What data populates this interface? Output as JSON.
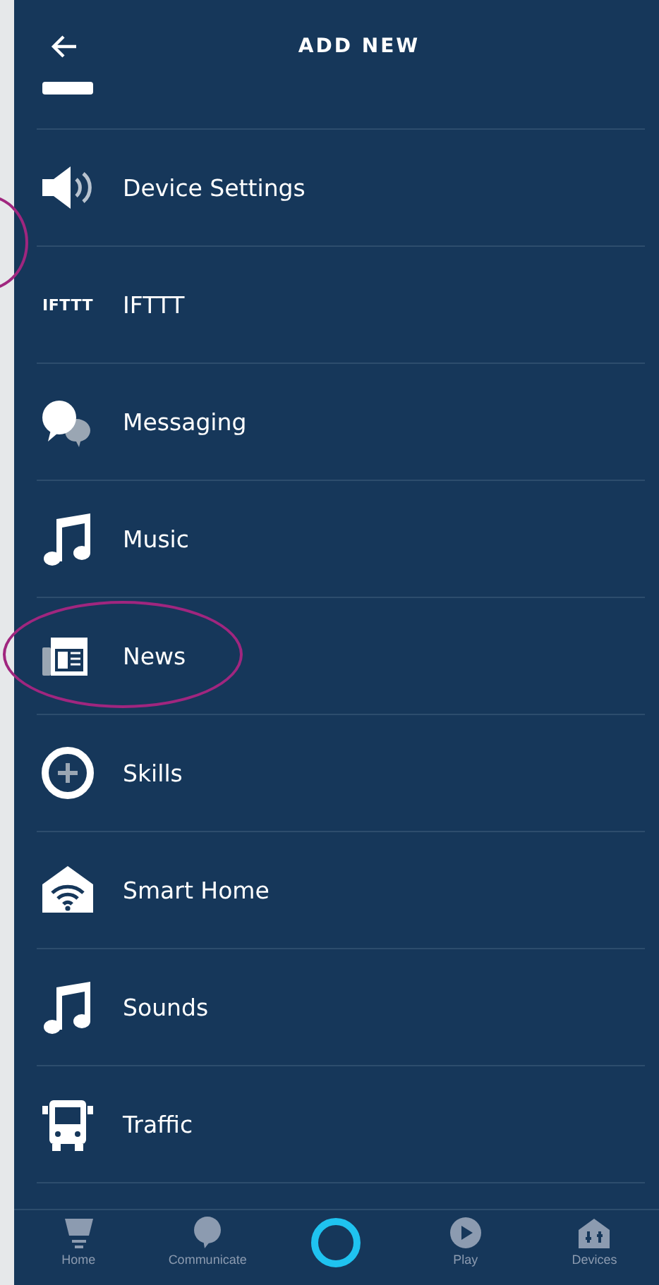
{
  "header": {
    "title": "ADD NEW"
  },
  "items": [
    {
      "label": "Device Settings",
      "highlight": {
        "kind": "arc"
      }
    },
    {
      "label": "IFTTT",
      "logo_text": "IFTTT"
    },
    {
      "label": "Messaging"
    },
    {
      "label": "Music"
    },
    {
      "label": "News",
      "highlight": {
        "kind": "ellipse"
      }
    },
    {
      "label": "Skills"
    },
    {
      "label": "Smart Home"
    },
    {
      "label": "Sounds"
    },
    {
      "label": "Traffic"
    }
  ],
  "nav": [
    {
      "kind": "tab",
      "label": "Home"
    },
    {
      "kind": "tab",
      "label": "Communicate"
    },
    {
      "kind": "assistant"
    },
    {
      "kind": "tab",
      "label": "Play"
    },
    {
      "kind": "tab",
      "label": "Devices"
    }
  ]
}
